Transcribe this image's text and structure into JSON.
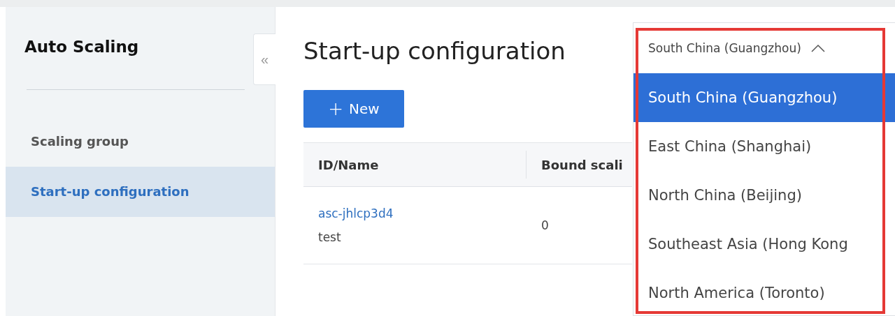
{
  "sidebar": {
    "title": "Auto Scaling",
    "collapse_icon": "«",
    "items": [
      {
        "label": "Scaling group",
        "selected": false
      },
      {
        "label": "Start-up configuration",
        "selected": true
      }
    ]
  },
  "page": {
    "title": "Start-up configuration",
    "new_button": {
      "icon": "+",
      "label": "New"
    }
  },
  "table": {
    "columns": [
      "ID/Name",
      "Bound scali"
    ],
    "rows": [
      {
        "id": "asc-jhlcp3d4",
        "name": "test",
        "column_2": "0"
      }
    ]
  },
  "region_select": {
    "value": "South China (Guangzhou)",
    "expanded": true,
    "options": [
      {
        "label": "South China (Guangzhou)",
        "selected": true
      },
      {
        "label": "East China (Shanghai)",
        "selected": false
      },
      {
        "label": "North China (Beijing)",
        "selected": false
      },
      {
        "label": "Southeast Asia (Hong Kong",
        "selected": false
      },
      {
        "label": "North America (Toronto)",
        "selected": false
      }
    ]
  }
}
